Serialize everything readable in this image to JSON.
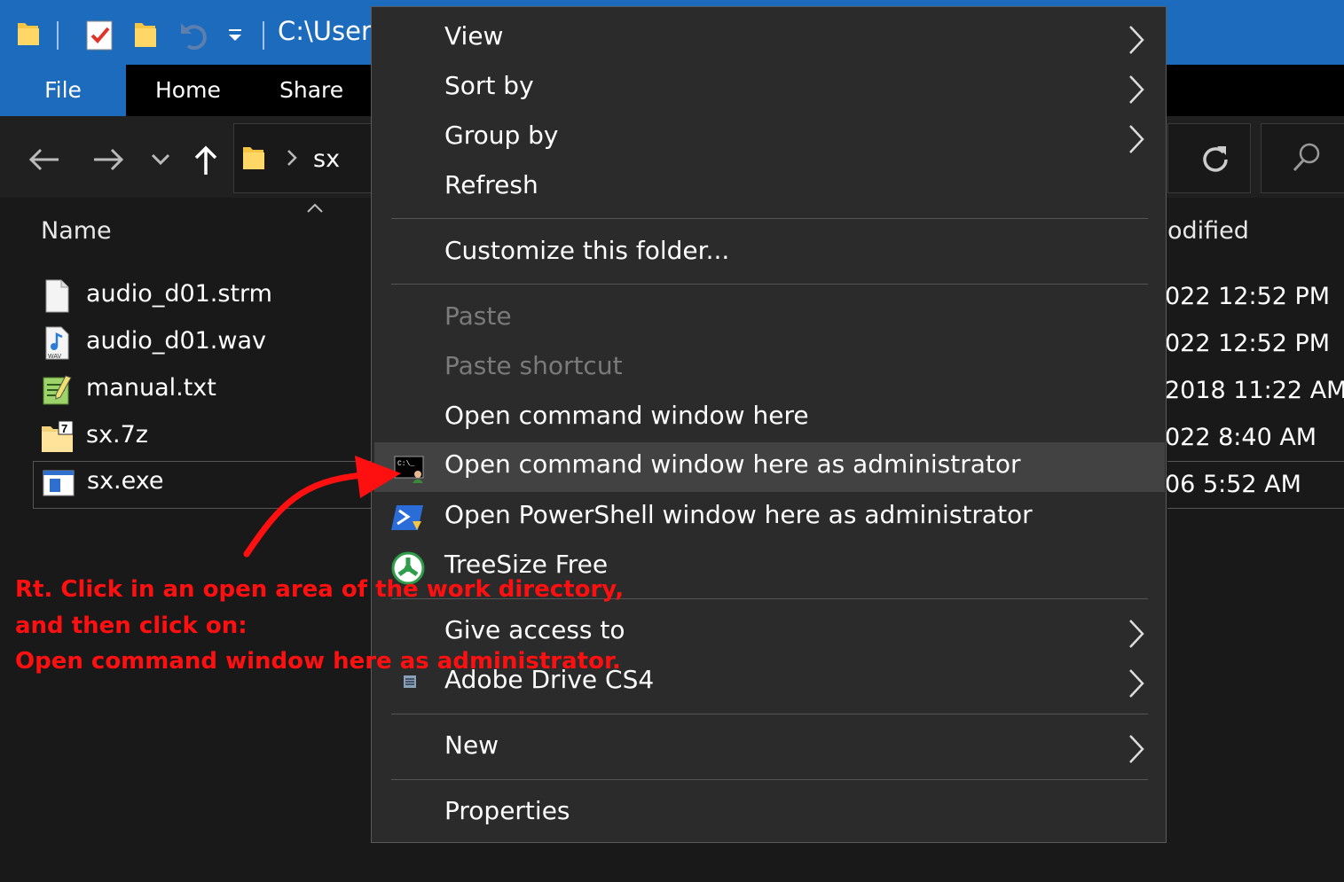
{
  "window": {
    "path_title": "C:\\Users",
    "ribbon_tabs": [
      "File",
      "Home",
      "Share"
    ]
  },
  "address": {
    "folder": "sx"
  },
  "columns": {
    "name": "Name",
    "date_modified_partial": "odified"
  },
  "files": [
    {
      "name": "audio_d01.strm",
      "icon": "blank-file-icon",
      "date": "022 12:52 PM"
    },
    {
      "name": "audio_d01.wav",
      "icon": "wav-file-icon",
      "date": "022 12:52 PM"
    },
    {
      "name": "manual.txt",
      "icon": "notepad-file-icon",
      "date": "2018 11:22 AM"
    },
    {
      "name": "sx.7z",
      "icon": "7z-archive-icon",
      "date": "022 8:40 AM"
    },
    {
      "name": "sx.exe",
      "icon": "exe-file-icon",
      "date": "06 5:52 AM"
    }
  ],
  "context_menu": {
    "view": "View",
    "sort_by": "Sort by",
    "group_by": "Group by",
    "refresh": "Refresh",
    "customize": "Customize this folder...",
    "paste": "Paste",
    "paste_shortcut": "Paste shortcut",
    "open_cmd": "Open command window here",
    "open_cmd_admin": "Open command window here as administrator",
    "open_ps_admin": "Open PowerShell window here as administrator",
    "treesize": "TreeSize Free",
    "give_access": "Give access to",
    "adobe_drive": "Adobe Drive CS4",
    "new": "New",
    "properties": "Properties"
  },
  "annotation": {
    "line1": "Rt. Click in an open area of the work directory,",
    "line2": "and then click on:",
    "line3": "Open command window here as administrator.",
    "color": "#ff1010"
  },
  "colors": {
    "accent": "#1c6bbd",
    "menu_bg": "#2b2b2b",
    "highlight": "#424242",
    "background": "#191919"
  }
}
